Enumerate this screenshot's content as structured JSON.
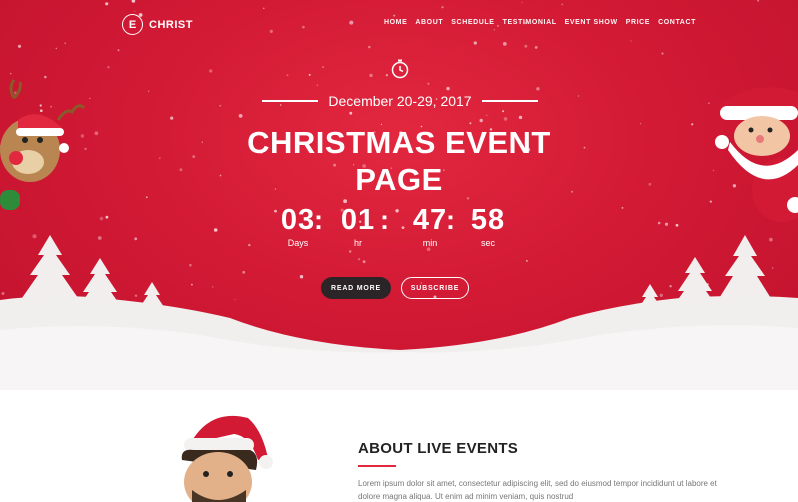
{
  "header": {
    "logo_letter": "E",
    "logo_text": "CHRIST",
    "nav": [
      "HOME",
      "ABOUT",
      "SCHEDULE",
      "TESTIMONIAL",
      "EVENT SHOW",
      "PRICE",
      "CONTACT"
    ]
  },
  "hero": {
    "date": "December 20-29, 2017",
    "title_line1": "CHRISTMAS EVENT",
    "title_line2": "PAGE",
    "countdown": [
      {
        "value": "03",
        "label": "Days"
      },
      {
        "value": "01",
        "label": "hr"
      },
      {
        "value": "47",
        "label": "min"
      },
      {
        "value": "58",
        "label": "sec"
      }
    ],
    "read_more": "READ MORE",
    "subscribe": "SUBSCRIBE"
  },
  "about": {
    "title": "ABOUT LIVE EVENTS",
    "text": "Lorem ipsum dolor sit amet, consectetur adipiscing elit, sed do eiusmod tempor incididunt ut labore et dolore magna aliqua. Ut enim ad minim veniam, quis nostrud"
  },
  "colors": {
    "hero_red": "#d31a35",
    "button_dark": "#2b2527",
    "accent": "#e2283f"
  },
  "icons": [
    "clock-icon",
    "reindeer-illustration",
    "santa-illustration",
    "santa-hat-man-photo"
  ]
}
